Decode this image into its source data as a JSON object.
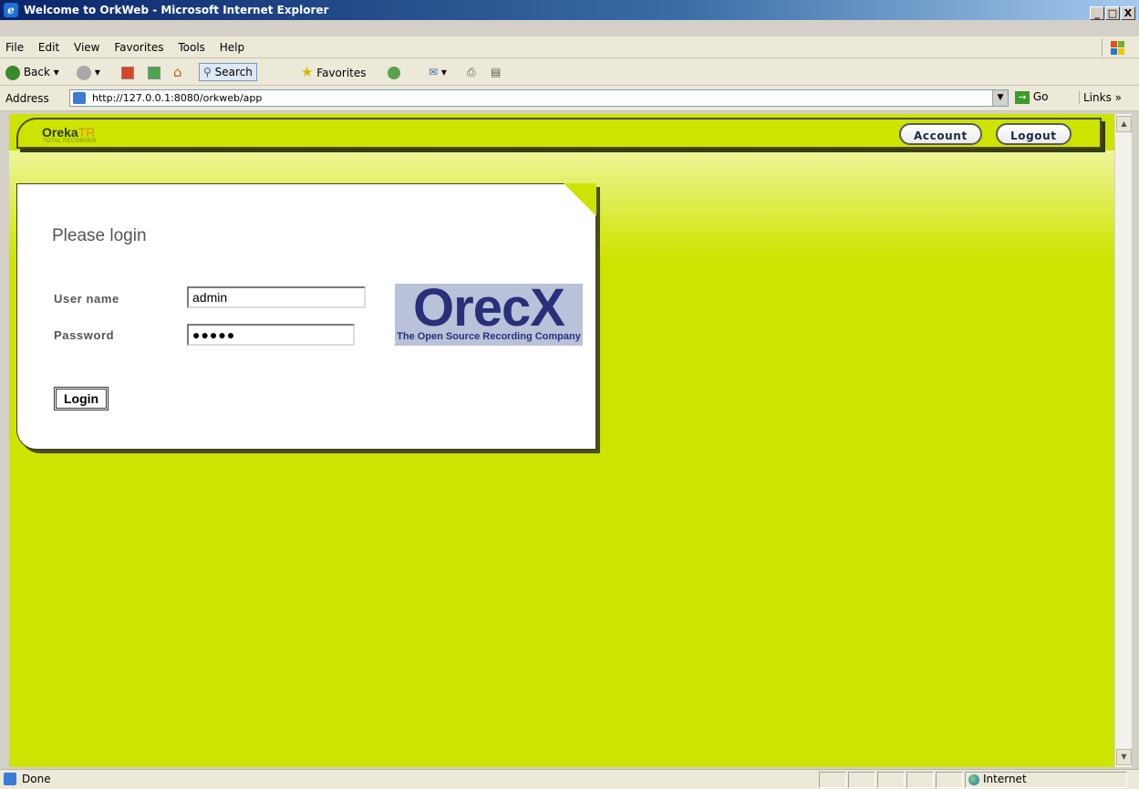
{
  "window": {
    "title": "Welcome to OrkWeb - Microsoft Internet Explorer",
    "minimize": "_",
    "maximize": "□",
    "close": "X"
  },
  "menu": [
    "File",
    "Edit",
    "View",
    "Favorites",
    "Tools",
    "Help"
  ],
  "toolbar": {
    "back": "Back",
    "search": "Search",
    "favorites": "Favorites"
  },
  "address": {
    "label": "Address",
    "url": "http://127.0.0.1:8080/orkweb/app",
    "go": "Go",
    "links": "Links"
  },
  "app": {
    "logo": "Oreka",
    "logo_suffix": "TR",
    "logo_sub": "TOTAL RECORDER",
    "account_button": "Account",
    "logout_button": "Logout"
  },
  "login": {
    "heading": "Please login",
    "username_label": "User name",
    "username_value": "admin",
    "password_label": "Password",
    "password_value": "●●●●●",
    "login_button": "Login",
    "brand": "OrecX",
    "brand_tagline": "The Open Source Recording Company"
  },
  "status": {
    "text": "Done",
    "zone": "Internet"
  },
  "colors": {
    "page_bg": "#cde300",
    "title_bar": "#0a246a"
  }
}
